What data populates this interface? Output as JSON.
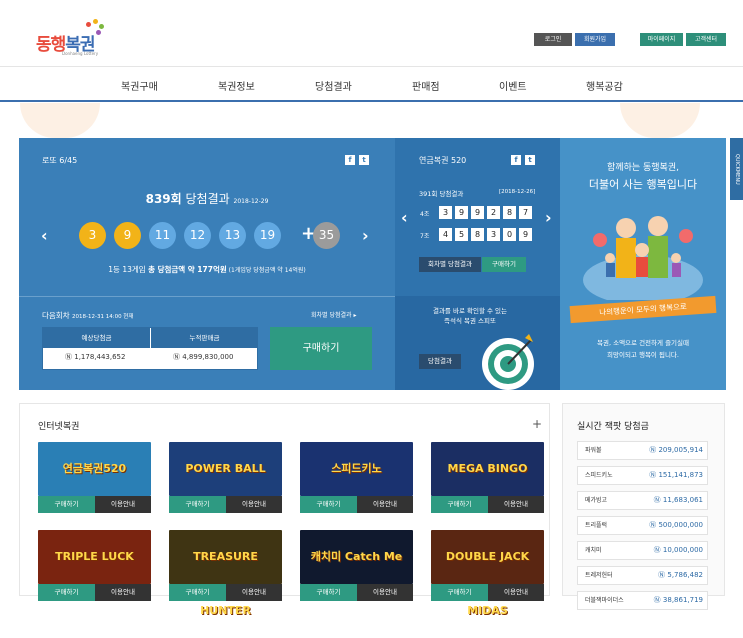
{
  "header": {
    "logo_text_a": "동행",
    "logo_text_b": "복권",
    "logo_sub": "Donhaeng Lottery",
    "login": "로그인",
    "join": "회원가입",
    "mypage": "마이페이지",
    "customer": "고객센터"
  },
  "nav": [
    "복권구매",
    "복권정보",
    "당첨결과",
    "판매점",
    "이벤트",
    "행복공감"
  ],
  "lotto": {
    "title": "로또 6/45",
    "round": "839회",
    "round_suffix": "당첨결과",
    "date": "2018-12-29",
    "balls": [
      {
        "n": "3",
        "color": "#f2b318"
      },
      {
        "n": "9",
        "color": "#f2b318"
      },
      {
        "n": "11",
        "color": "#62a9e2"
      },
      {
        "n": "12",
        "color": "#62a9e2"
      },
      {
        "n": "13",
        "color": "#62a9e2"
      },
      {
        "n": "19",
        "color": "#62a9e2"
      }
    ],
    "plus": "+",
    "bonus": {
      "n": "35",
      "color": "#9b9b9b"
    },
    "prize_text_a": "1등 13게임 ",
    "prize_text_b": "총 당첨금액 약 177억원",
    "prize_text_c": " (1게임당 당첨금액 약 14억원)",
    "next_label": "다음회차",
    "next_date": "2018-12-31 14:00 현재",
    "round_result_link": "회차별 당첨결과",
    "expected_label": "예상당첨금",
    "cumulative_label": "누적판매금",
    "expected_value": "1,178,443,652",
    "cumulative_value": "4,899,830,000",
    "buy": "구매하기"
  },
  "pension": {
    "title": "연금복권 520",
    "round": "391회 당첨결과",
    "date": "[2018-12-26]",
    "row1_label": "4조",
    "row1_digits": [
      "3",
      "9",
      "9",
      "2",
      "8",
      "7"
    ],
    "row2_label": "7조",
    "row2_digits": [
      "4",
      "5",
      "8",
      "3",
      "0",
      "9"
    ],
    "round_btn": "회차별 당첨결과",
    "buy_btn": "구매하기",
    "scratch_a": "결과를 바로 확인할 수 있는",
    "scratch_b": "즉석식 복권 스피또",
    "result_btn": "당첨결과"
  },
  "promo": {
    "line1": "함께하는 동행복권,",
    "line2": "더불어 사는 행복입니다",
    "ribbon": "나의행운이 모두의 행복으로",
    "desc1": "복권, 소액으로 건전하게 즐기실때",
    "desc2": "희망이되고 행복이 됩니다."
  },
  "quickmenu": "QUICKMENU",
  "internet": {
    "title": "인터넷복권",
    "plus": "+",
    "buy": "구매하기",
    "guide": "이용안내",
    "games": [
      {
        "name": "연금복권520",
        "bg": "#2a7fb5"
      },
      {
        "name": "POWER BALL",
        "bg": "#1d3f7a"
      },
      {
        "name": "스피드키노",
        "bg": "#1a3270"
      },
      {
        "name": "MEGA BINGO",
        "bg": "#1b2e63"
      },
      {
        "name": "TRIPLE LUCK",
        "bg": "#7a2410"
      },
      {
        "name": "TREASURE HUNTER",
        "bg": "#3f3413"
      },
      {
        "name": "캐치미 Catch Me",
        "bg": "#10192e"
      },
      {
        "name": "DOUBLE JACK MIDAS",
        "bg": "#5a2612"
      }
    ]
  },
  "jackpot": {
    "title": "실시간 잭팟 당첨금",
    "rows": [
      {
        "name": "파워볼",
        "value": "209,005,914"
      },
      {
        "name": "스피드키노",
        "value": "151,141,873"
      },
      {
        "name": "메가빙고",
        "value": "11,683,061"
      },
      {
        "name": "트리플럭",
        "value": "500,000,000"
      },
      {
        "name": "캐치미",
        "value": "10,000,000"
      },
      {
        "name": "트레저헌터",
        "value": "5,786,482"
      },
      {
        "name": "더블잭마이더스",
        "value": "38,861,719"
      }
    ]
  }
}
